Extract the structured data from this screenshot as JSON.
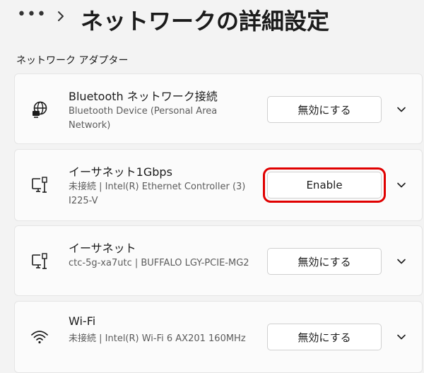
{
  "header": {
    "title": "ネットワークの詳細設定",
    "more_icon": "more-horizontal-icon",
    "separator_icon": "chevron-right-icon"
  },
  "section": {
    "label": "ネットワーク アダプター"
  },
  "adapters": [
    {
      "name": "Bluetooth ネットワーク接続",
      "description": "Bluetooth Device (Personal Area Network)",
      "button_label": "無効にする",
      "icon": "globe-network-icon",
      "highlighted": false
    },
    {
      "name": "イーサネット1Gbps",
      "description": "未接続 | Intel(R) Ethernet Controller (3) I225-V",
      "button_label": "Enable",
      "icon": "ethernet-icon",
      "highlighted": true,
      "highlight_color": "#e00000"
    },
    {
      "name": "イーサネット",
      "description": "ctc-5g-xa7utc | BUFFALO LGY-PCIE-MG2",
      "button_label": "無効にする",
      "icon": "ethernet-icon",
      "highlighted": false
    },
    {
      "name": "Wi-Fi",
      "description": "未接続 | Intel(R) Wi-Fi 6 AX201 160MHz",
      "button_label": "無効にする",
      "icon": "wifi-icon",
      "highlighted": false
    }
  ]
}
